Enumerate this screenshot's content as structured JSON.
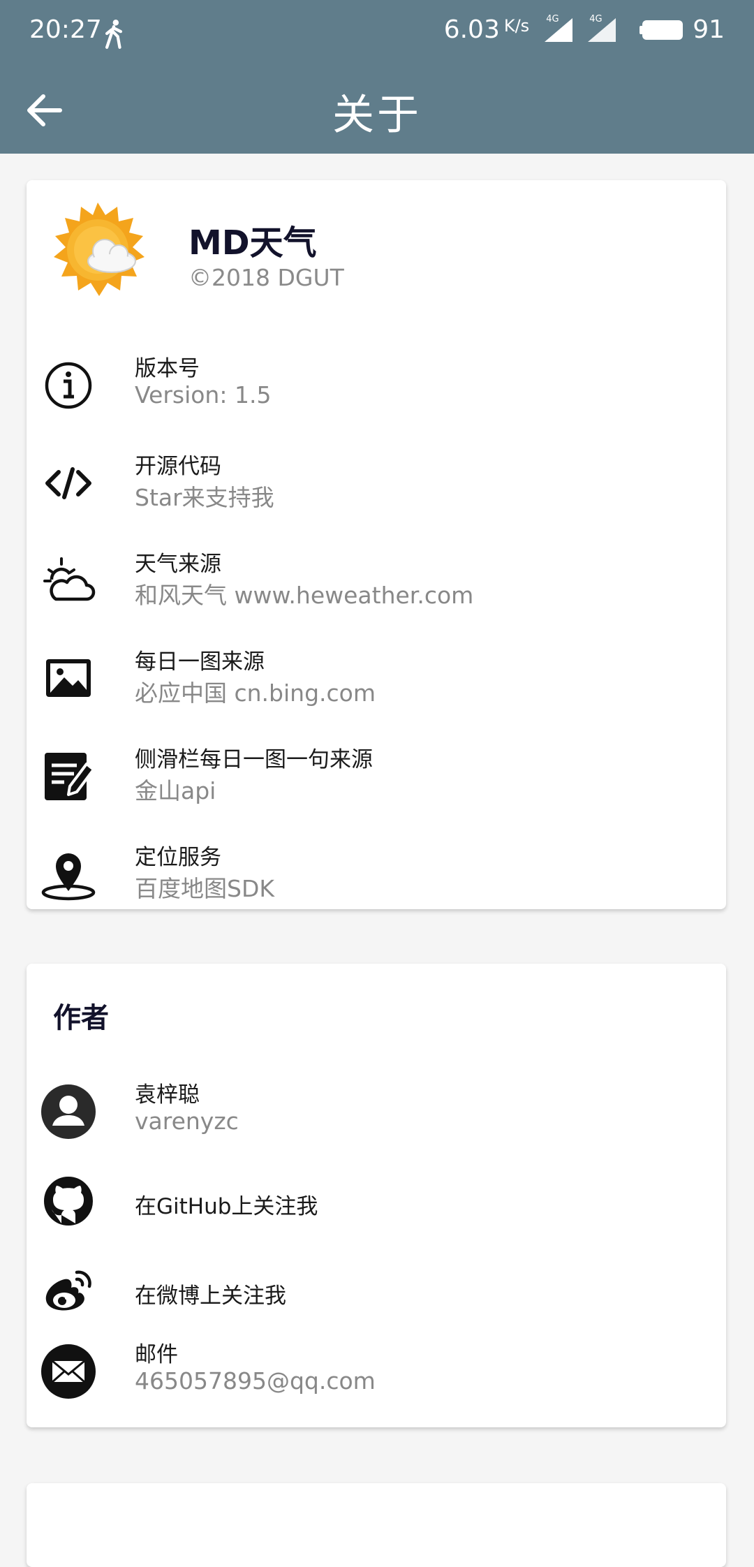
{
  "status_bar": {
    "time": "20:27",
    "speed": "6.03",
    "speed_unit": "K/s",
    "signal_1_label": "4G",
    "signal_2_label": "4G",
    "battery": "91"
  },
  "app_bar": {
    "title": "关于"
  },
  "app_card": {
    "name": "MD天气",
    "copyright": "©2018 DGUT",
    "items": [
      {
        "title": "版本号",
        "subtitle": "Version: 1.5",
        "icon": "info-icon"
      },
      {
        "title": "开源代码",
        "subtitle": "Star来支持我",
        "icon": "code-icon"
      },
      {
        "title": "天气来源",
        "subtitle": "和风天气 www.heweather.com",
        "icon": "weather-cloud-icon"
      },
      {
        "title": "每日一图来源",
        "subtitle": "必应中国 cn.bing.com",
        "icon": "image-icon"
      },
      {
        "title": "侧滑栏每日一图一句来源",
        "subtitle": "金山api",
        "icon": "note-edit-icon"
      },
      {
        "title": "定位服务",
        "subtitle": "百度地图SDK",
        "icon": "location-pin-icon"
      }
    ]
  },
  "author_card": {
    "section_title": "作者",
    "items": [
      {
        "title": "袁梓聪",
        "subtitle": "varenyzc",
        "icon": "account-icon"
      },
      {
        "title": "在GitHub上关注我",
        "icon": "github-icon"
      },
      {
        "title": "在微博上关注我",
        "icon": "weibo-icon"
      },
      {
        "title": "邮件",
        "subtitle": "465057895@qq.com",
        "icon": "email-icon"
      }
    ]
  },
  "colors": {
    "primary": "#607d8b",
    "background": "#f5f5f5",
    "card": "#ffffff",
    "title_text": "#12122b",
    "secondary_text": "#888888"
  }
}
